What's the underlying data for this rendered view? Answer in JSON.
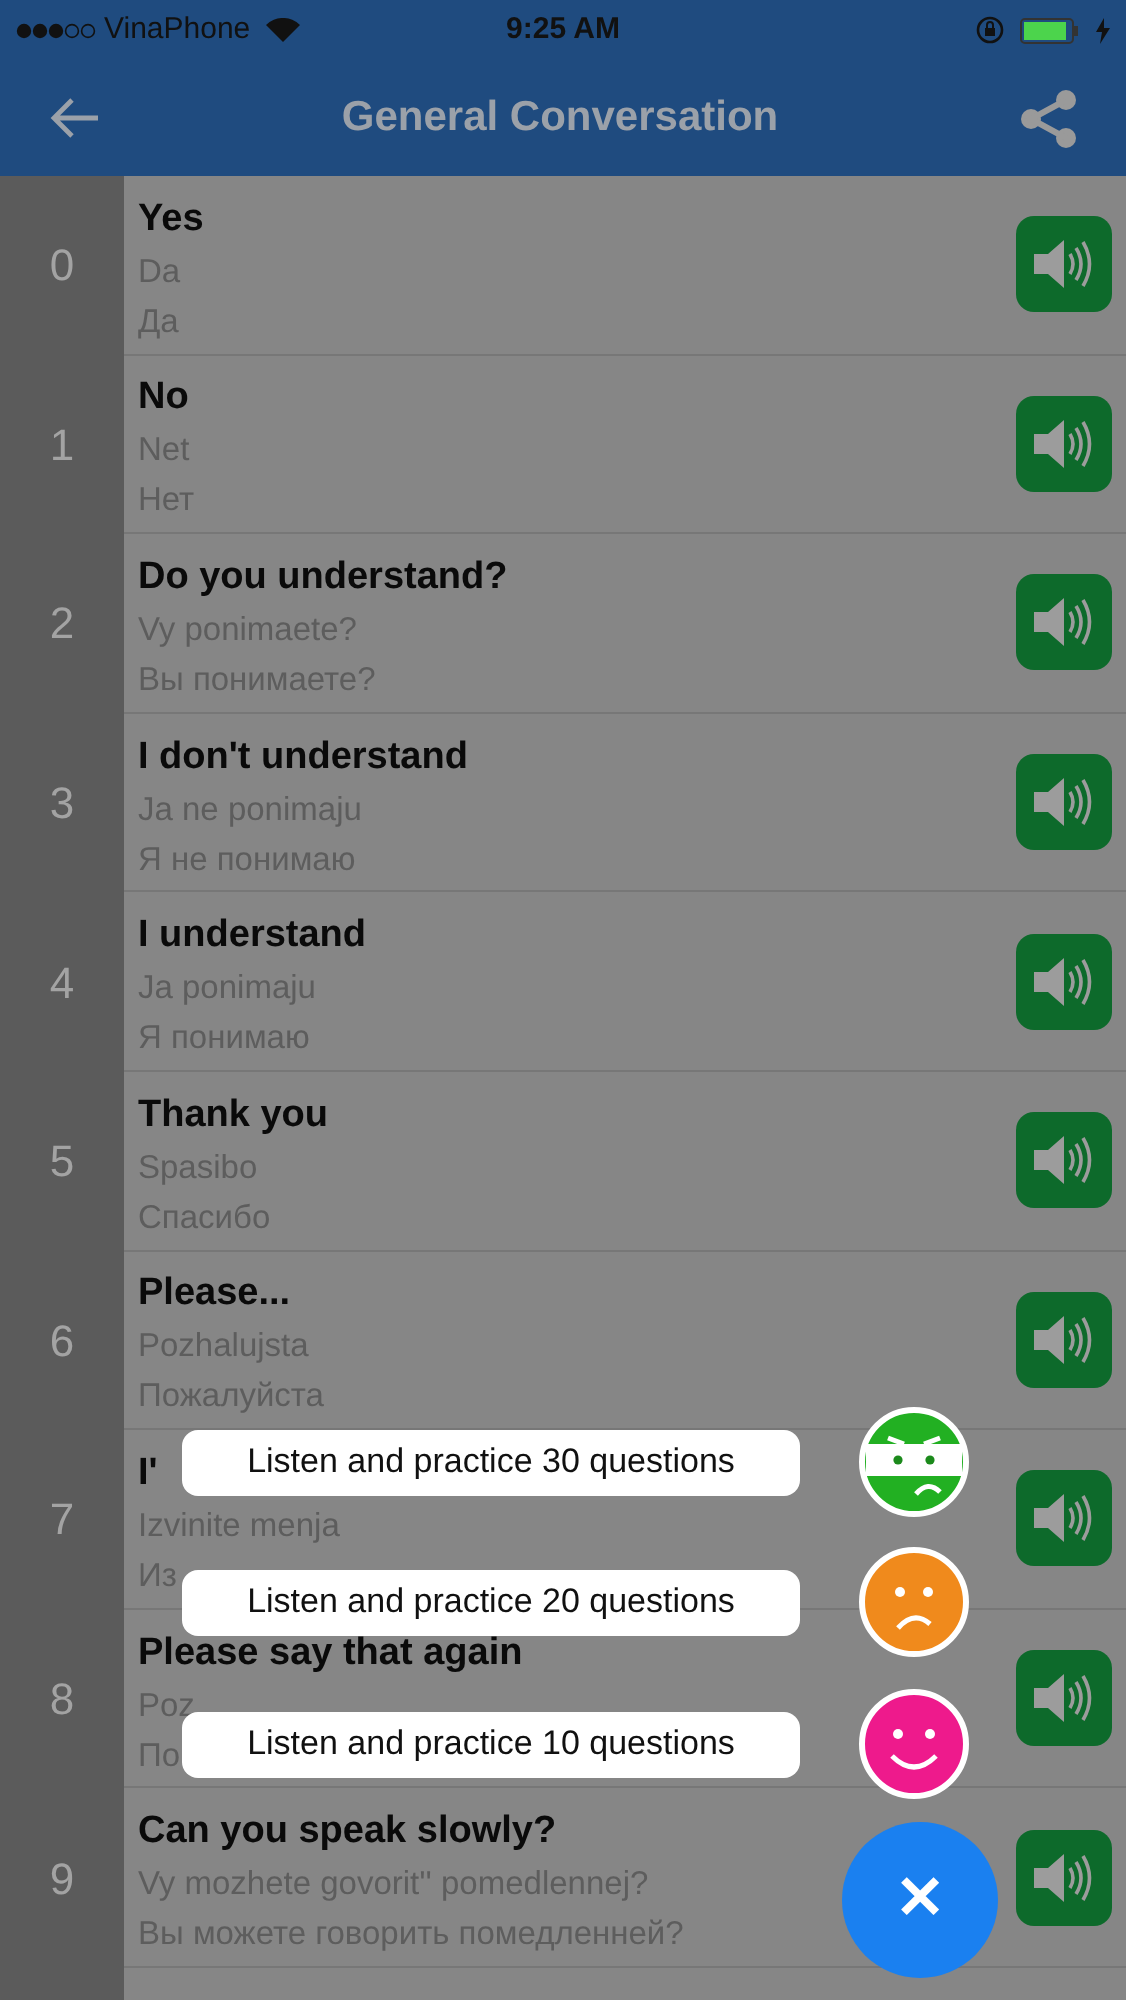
{
  "status_bar": {
    "carrier": "VinaPhone",
    "time": "9:25 AM"
  },
  "header": {
    "title": "General Conversation"
  },
  "rows": [
    {
      "number": "0",
      "title": "Yes",
      "transliteration": "Da",
      "cyrillic": "Да"
    },
    {
      "number": "1",
      "title": "No",
      "transliteration": "Net",
      "cyrillic": "Нет"
    },
    {
      "number": "2",
      "title": "Do you understand?",
      "transliteration": "Vy ponimaete?",
      "cyrillic": "Вы понимаете?"
    },
    {
      "number": "3",
      "title": "I don't understand",
      "transliteration": "Ja ne ponimaju",
      "cyrillic": "Я не понимаю"
    },
    {
      "number": "4",
      "title": "I understand",
      "transliteration": "Ja ponimaju",
      "cyrillic": "Я понимаю"
    },
    {
      "number": "5",
      "title": "Thank you",
      "transliteration": "Spasibo",
      "cyrillic": "Спасибо"
    },
    {
      "number": "6",
      "title": "Please...",
      "transliteration": "Pozhalujsta",
      "cyrillic": "Пожалуйста"
    },
    {
      "number": "7",
      "title": "I'",
      "transliteration": "Izvinite menja",
      "cyrillic": "Из"
    },
    {
      "number": "8",
      "title": "Please say that again",
      "transliteration": "Poz",
      "cyrillic": "По"
    },
    {
      "number": "9",
      "title": "Can you speak slowly?",
      "transliteration": "Vy mozhete govorit'' pomedlennej?",
      "cyrillic": "Вы можете говорить помедленней?"
    }
  ],
  "quiz_menu": {
    "options": [
      {
        "label": "Listen and practice 30 questions",
        "kind": "masked",
        "color": "#22b022"
      },
      {
        "label": "Listen and practice 20 questions",
        "kind": "sad",
        "color": "#f08a1c"
      },
      {
        "label": "Listen and practice 10 questions",
        "kind": "happy",
        "color": "#ee1a8c"
      }
    ],
    "close_label": "✕"
  }
}
